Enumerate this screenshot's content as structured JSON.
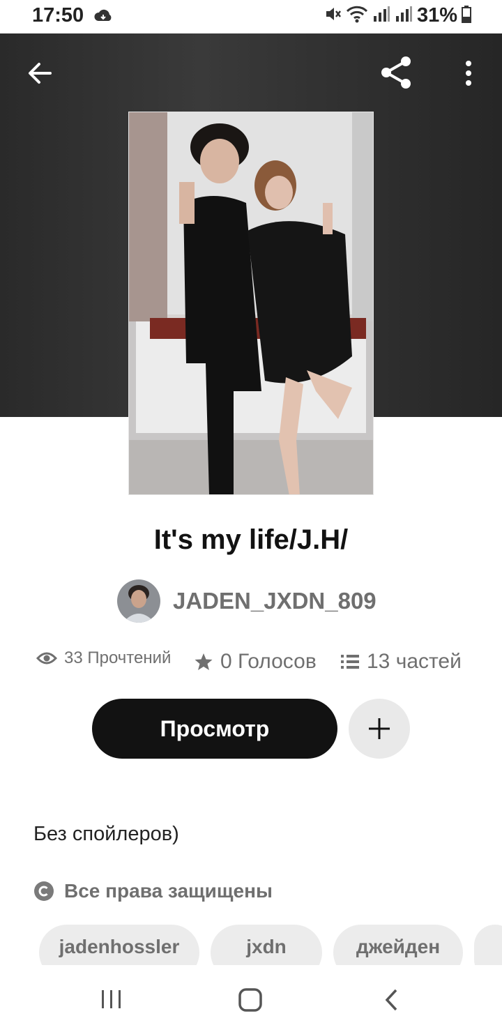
{
  "status_bar": {
    "time": "17:50",
    "battery": "31%"
  },
  "toolbar": {
    "back_icon": "arrow-left-icon",
    "share_icon": "share-icon",
    "more_icon": "more-vertical-icon"
  },
  "story": {
    "title": "It's my life/J.H/",
    "author": "JADEN_JXDN_809",
    "reads": "33 Прочтений",
    "votes": "0 Голосов",
    "parts": "13 частей",
    "read_button": "Просмотр",
    "description": "Без спойлеров)",
    "copyright": "Все права защищены",
    "tags": [
      "jadenhossler",
      "jxdn",
      "джейден"
    ]
  },
  "colors": {
    "header_bg": "#2f2f2f",
    "primary_button": "#121212",
    "secondary_text": "#6f6f6f",
    "tag_bg": "#ececec"
  }
}
